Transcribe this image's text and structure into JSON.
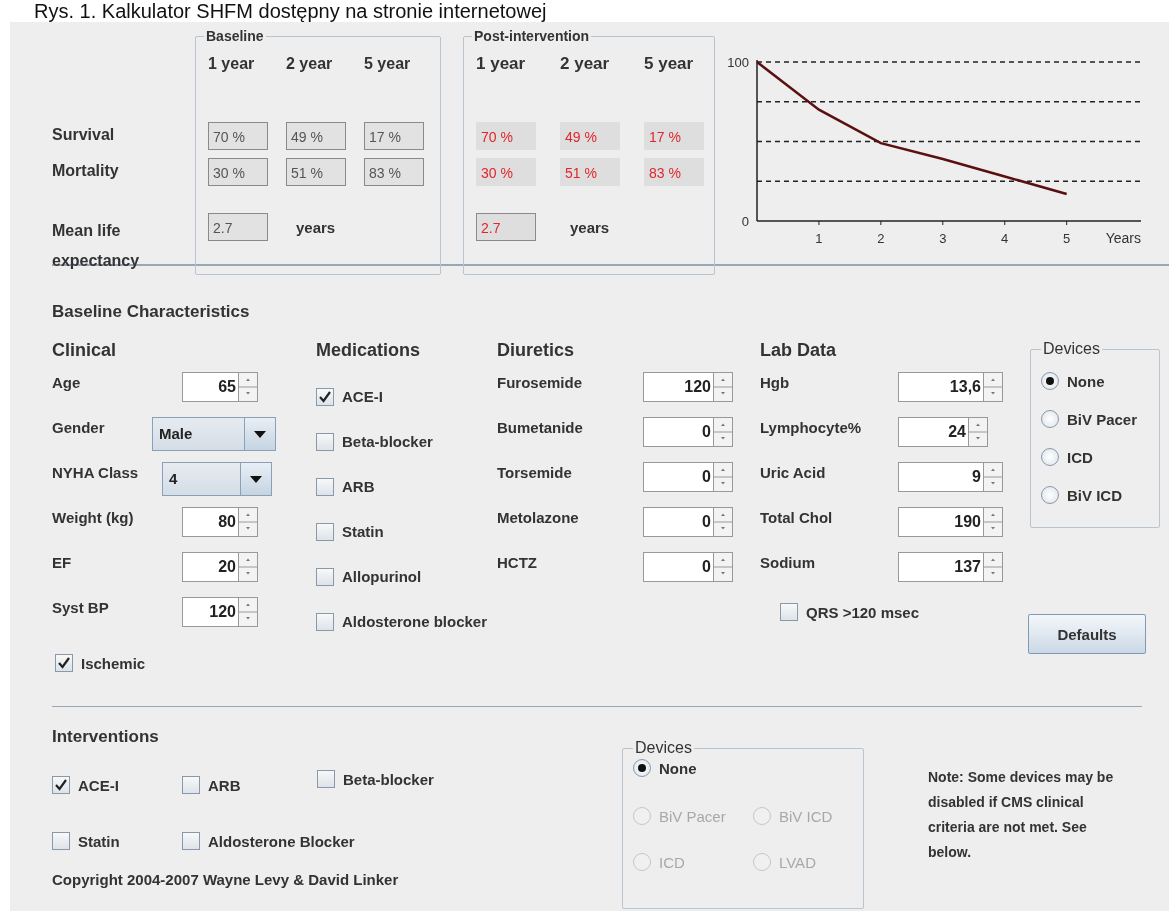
{
  "caption": "Rys. 1. Kalkulator SHFM dostępny na stronie internetowej",
  "results": {
    "row_labels": [
      "Survival",
      "Mortality",
      "Mean life expectancy"
    ],
    "panels": [
      {
        "kind": "baseline",
        "title": "Baseline",
        "columns": [
          "1 year",
          "2 year",
          "5 year"
        ],
        "survival": [
          "70 %",
          "49 %",
          "17 %"
        ],
        "mortality": [
          "30 %",
          "51 %",
          "83 %"
        ],
        "life_expectancy": "2.7",
        "unit": "years"
      },
      {
        "kind": "post",
        "title": "Post-intervention",
        "columns": [
          "1 year",
          "2 year",
          "5 year"
        ],
        "survival": [
          "70 %",
          "49 %",
          "17 %"
        ],
        "mortality": [
          "30 %",
          "51 %",
          "83 %"
        ],
        "life_expectancy": "2.7",
        "unit": "years"
      }
    ]
  },
  "chart": {
    "chart_data": {
      "type": "line",
      "xlabel": "Years",
      "x": [
        0,
        1,
        2,
        3,
        4,
        5
      ],
      "series": [
        {
          "color": "#5a1010",
          "values": [
            100,
            70,
            49,
            39,
            28,
            17
          ]
        }
      ],
      "xlim": [
        0,
        6.2
      ],
      "ylim": [
        0,
        100
      ],
      "xticks": [
        1,
        2,
        3,
        4,
        5
      ],
      "yticks": [
        0,
        100
      ]
    }
  },
  "baseline_characteristics": {
    "title": "Baseline Characteristics",
    "clinical": {
      "title": "Clinical",
      "fields": [
        {
          "kind": "spinner",
          "label": "Age",
          "value": "65"
        },
        {
          "kind": "dropdown",
          "label": "Gender",
          "value": "Male"
        },
        {
          "kind": "dropdown",
          "label": "NYHA Class",
          "value": "4"
        },
        {
          "kind": "spinner",
          "label": "Weight (kg)",
          "value": "80"
        },
        {
          "kind": "spinner",
          "label": "EF",
          "value": "20"
        },
        {
          "kind": "spinner",
          "label": "Syst BP",
          "value": "120"
        }
      ],
      "ischemic": {
        "label": "Ischemic",
        "checked": true
      }
    },
    "medications": {
      "title": "Medications",
      "items": [
        {
          "label": "ACE-I",
          "checked": true
        },
        {
          "label": "Beta-blocker",
          "checked": false
        },
        {
          "label": "ARB",
          "checked": false
        },
        {
          "label": "Statin",
          "checked": false
        },
        {
          "label": "Allopurinol",
          "checked": false
        },
        {
          "label": "Aldosterone blocker",
          "checked": false
        }
      ]
    },
    "diuretics": {
      "title": "Diuretics",
      "fields": [
        {
          "label": "Furosemide",
          "value": "120"
        },
        {
          "label": "Bumetanide",
          "value": "0"
        },
        {
          "label": "Torsemide",
          "value": "0"
        },
        {
          "label": "Metolazone",
          "value": "0"
        },
        {
          "label": "HCTZ",
          "value": "0"
        }
      ]
    },
    "lab_data": {
      "title": "Lab Data",
      "fields": [
        {
          "label": "Hgb",
          "value": "13,6"
        },
        {
          "label": "Lymphocyte%",
          "value": "24"
        },
        {
          "label": "Uric Acid",
          "value": "9"
        },
        {
          "label": "Total Chol",
          "value": "190"
        },
        {
          "label": "Sodium",
          "value": "137"
        }
      ],
      "qrs": {
        "label": "QRS >120 msec",
        "checked": false
      }
    },
    "devices": {
      "title": "Devices",
      "options": [
        {
          "label": "None",
          "selected": true
        },
        {
          "label": "BiV Pacer",
          "selected": false
        },
        {
          "label": "ICD",
          "selected": false
        },
        {
          "label": "BiV ICD",
          "selected": false
        }
      ]
    },
    "defaults_button": "Defaults"
  },
  "interventions": {
    "title": "Interventions",
    "drugs": [
      {
        "label": "ACE-I",
        "checked": true
      },
      {
        "label": "ARB",
        "checked": false
      },
      {
        "label": "Beta-blocker",
        "checked": false
      },
      {
        "label": "Statin",
        "checked": false
      },
      {
        "label": "Aldosterone Blocker",
        "checked": false
      }
    ],
    "devices": {
      "title": "Devices",
      "options": [
        {
          "label": "None",
          "selected": true,
          "disabled": false
        },
        {
          "label": "BiV Pacer",
          "selected": false,
          "disabled": true
        },
        {
          "label": "BiV ICD",
          "selected": false,
          "disabled": true
        },
        {
          "label": "ICD",
          "selected": false,
          "disabled": true
        },
        {
          "label": "LVAD",
          "selected": false,
          "disabled": true
        }
      ]
    },
    "note": "Note: Some devices may be disabled if CMS clinical criteria are not met. See below.",
    "copyright": "Copyright 2004-2007 Wayne Levy & David Linker"
  }
}
